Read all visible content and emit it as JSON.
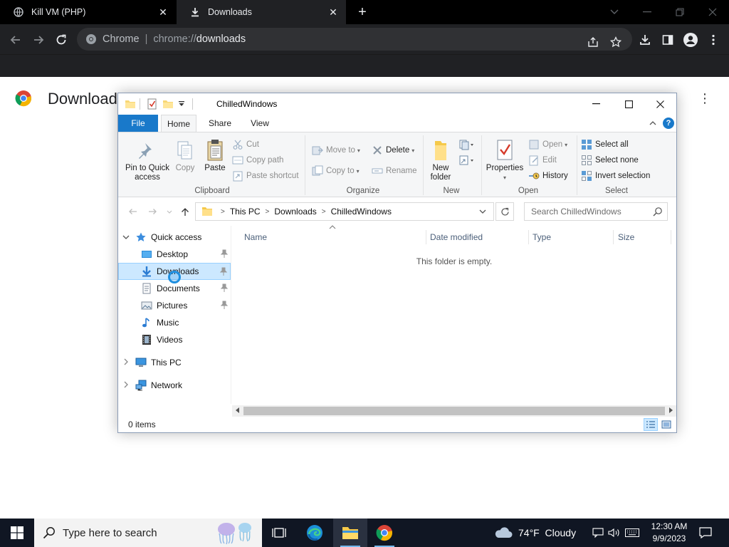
{
  "browser": {
    "tabs": [
      {
        "title": "Kill VM (PHP)"
      },
      {
        "title": "Downloads"
      }
    ],
    "omnibox": {
      "site_label": "Chrome",
      "url_prefix": "chrome://",
      "url_path": "downloads"
    },
    "page_title": "Downloads"
  },
  "explorer": {
    "title": "ChilledWindows",
    "ribbon_tabs": [
      "File",
      "Home",
      "Share",
      "View"
    ],
    "ribbon": {
      "clipboard": {
        "label": "Clipboard",
        "pin": "Pin to Quick access",
        "pin_line1": "Pin to Quick",
        "pin_line2": "access",
        "copy": "Copy",
        "paste": "Paste",
        "cut": "Cut",
        "copy_path": "Copy path",
        "paste_shortcut": "Paste shortcut"
      },
      "organize": {
        "label": "Organize",
        "move_to": "Move to",
        "copy_to": "Copy to",
        "delete": "Delete",
        "rename": "Rename"
      },
      "new": {
        "label": "New",
        "new_folder_line1": "New",
        "new_folder_line2": "folder"
      },
      "open": {
        "label": "Open",
        "properties": "Properties",
        "open": "Open",
        "edit": "Edit",
        "history": "History"
      },
      "select": {
        "label": "Select",
        "select_all": "Select all",
        "select_none": "Select none",
        "invert": "Invert selection"
      }
    },
    "address": {
      "crumbs": [
        "This PC",
        "Downloads",
        "ChilledWindows"
      ]
    },
    "search_placeholder": "Search ChilledWindows",
    "nav": {
      "quick_access": "Quick access",
      "items": [
        {
          "label": "Desktop",
          "pinned": true
        },
        {
          "label": "Downloads",
          "pinned": true,
          "selected": true
        },
        {
          "label": "Documents",
          "pinned": true
        },
        {
          "label": "Pictures",
          "pinned": true
        },
        {
          "label": "Music",
          "pinned": false
        },
        {
          "label": "Videos",
          "pinned": false
        }
      ],
      "this_pc": "This PC",
      "network": "Network"
    },
    "columns": [
      "Name",
      "Date modified",
      "Type",
      "Size"
    ],
    "empty_message": "This folder is empty.",
    "status": "0 items"
  },
  "taskbar": {
    "search_placeholder": "Type here to search",
    "weather": "74°F  Cloudy",
    "time": "12:30 AM",
    "date": "9/9/2023"
  },
  "colors": {
    "chrome_dark": "#202124",
    "file_tab_blue": "#1979ca",
    "selection": "#cce8ff",
    "taskbar": "#101623"
  }
}
